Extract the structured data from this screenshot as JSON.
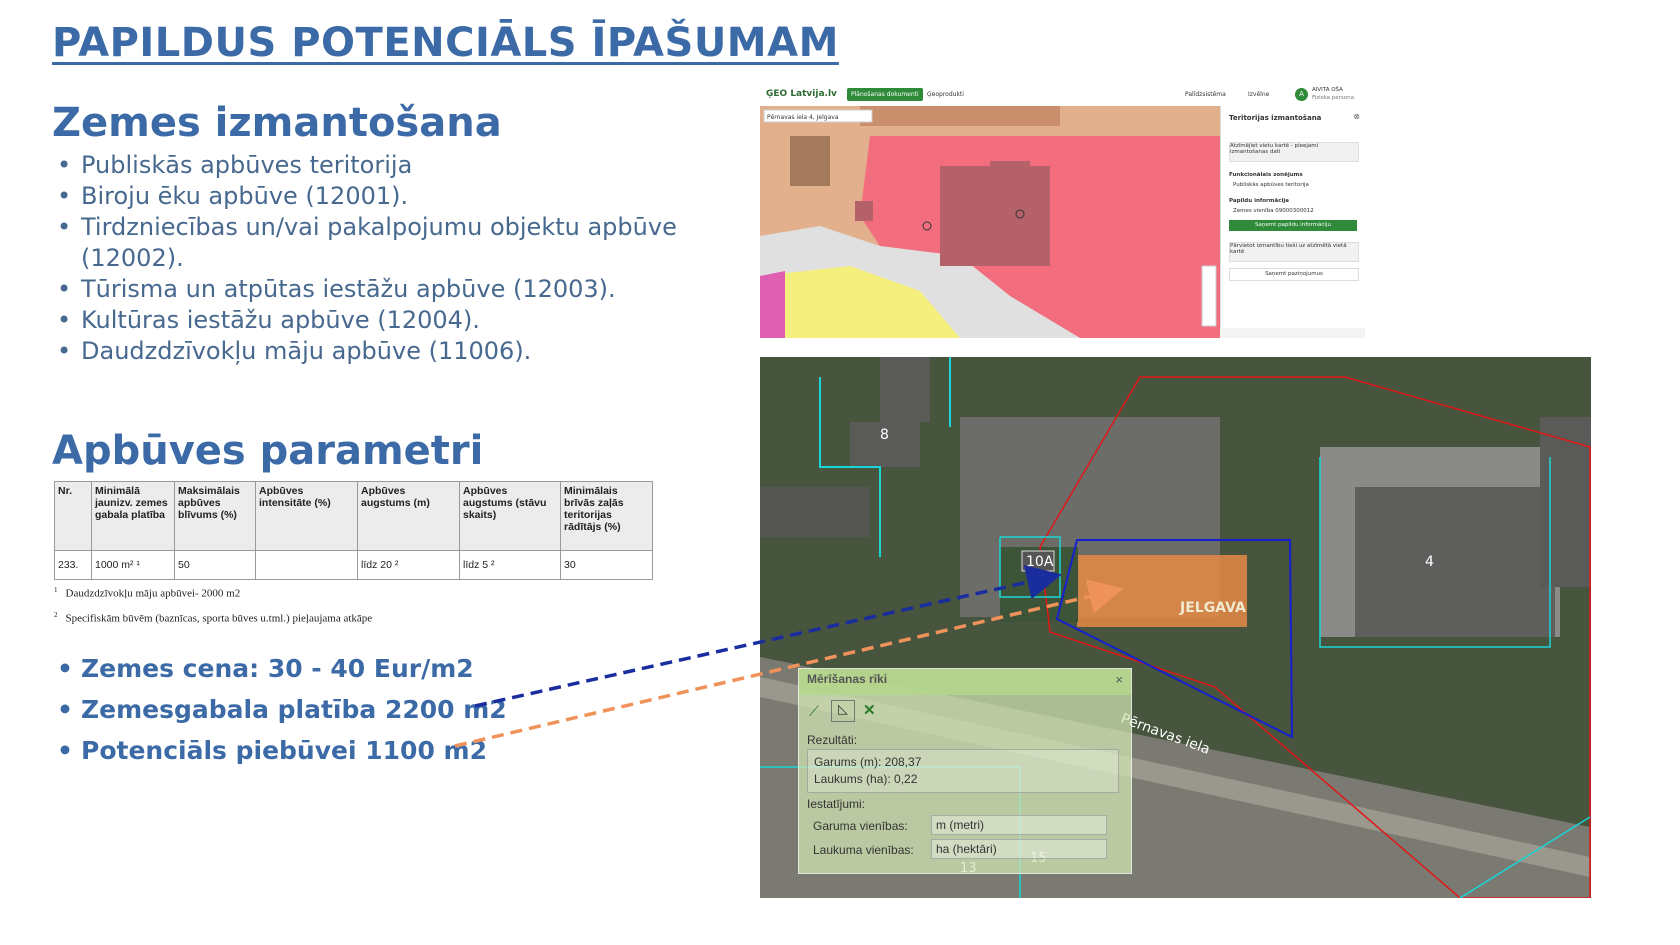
{
  "slide": {
    "title": "PAPILDUS POTENCIĀLS ĪPAŠUMAM",
    "land_use_heading": "Zemes izmantošana",
    "land_uses": [
      "Publiskās apbūves teritorija",
      "Biroju ēku apbūve (12001).",
      "Tirdzniecības un/vai pakalpojumu objektu apbūve (12002).",
      "Tūrisma un atpūtas iestāžu apbūve  (12003).",
      " Kultūras iestāžu apbūve (12004).",
      " Daudzdzīvokļu māju apbūve (11006)."
    ],
    "params_heading": "Apbūves parametri",
    "table": {
      "headers": [
        "Nr.",
        "Minimālā jaunizv. zemes gabala platība",
        "Maksimālais apbūves blīvums (%)",
        "Apbūves intensitāte (%)",
        "Apbūves augstums (m)",
        "Apbūves augstums (stāvu skaits)",
        "Minimālais brīvās zaļās teritorijas rādītājs (%)"
      ],
      "row": [
        "233.",
        "1000 m² ¹",
        "50",
        "",
        "līdz 20 ²",
        "līdz 5 ²",
        "30"
      ]
    },
    "footnotes": [
      {
        "mark": "1",
        "text": "Daudzdzīvokļu māju apbūvei- 2000 m2"
      },
      {
        "mark": "2",
        "text": "Specifiskām būvēm (baznīcas, sporta būves u.tml.) pieļaujama atkāpe"
      }
    ],
    "facts": [
      "Zemes cena: 30 - 40 Eur/m2",
      "Zemesgabala platība 2200 m2",
      "Potenciāls piebūvei 1100 m2"
    ],
    "arrow_colors": {
      "area": "#1a2d9e",
      "potential": "#f0935a"
    }
  },
  "geo_portal": {
    "logo": "ĢEO Latvija.lv",
    "nav_active": "Plānošanas dokumenti",
    "nav_other": "Ģeoprodukti",
    "nav_help": "Palīdzsistēma",
    "nav_menu": "Izvēlne",
    "user_name": "AIVITA OŠA",
    "user_role": "Fiziska persona",
    "user_initial": "A",
    "search_value": "Pērnavas iela 4, Jelgava",
    "side_title": "Teritorijas izmantošana",
    "side_info": "Atzīmējiet vietu kartē - pieejami izmantošanas dati",
    "side_zoning_label": "Funkcionālais zonējums",
    "side_zoning_value": "Publiskās apbūves teritorija",
    "side_extra_label": "Papildu informācija",
    "side_extra_value": "Zemes vienība 09000300012",
    "side_button": "Saņemt papildu informāciju",
    "side_note": "Pārvietot izmantību tieši uz atzīmētā vietā kartē",
    "side_button2": "Saņemt paziņojumus"
  },
  "aerial": {
    "labels": [
      "8",
      "10A",
      "4",
      "13",
      "15",
      "JELGAVA"
    ],
    "street": "Pērnavas iela"
  },
  "measure_tool": {
    "title": "Mērīšanas rīki",
    "results_label": "Rezultāti:",
    "length": "Garums (m): 208,37",
    "area": "Laukums (ha): 0,22",
    "settings_label": "Iestatījumi:",
    "length_units_label": "Garuma vienības:",
    "length_units_value": "m (metri)",
    "area_units_label": "Laukuma vienības:",
    "area_units_value": "ha (hektāri)"
  }
}
